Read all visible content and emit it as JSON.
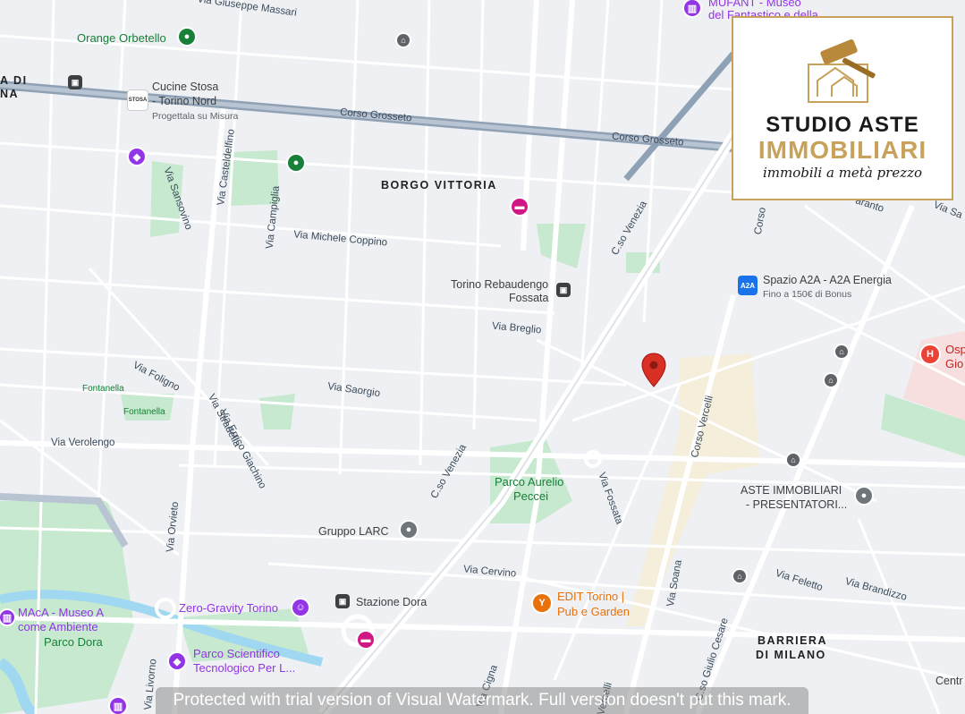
{
  "neighborhoods": {
    "borgo_vittoria": "BORGO VITTORIA",
    "barriera_1": "BARRIERA",
    "barriera_2": "DI MILANO",
    "left_cut_1": "A DI",
    "left_cut_2": "NA"
  },
  "streets": {
    "corso_grosseto_1": "Corso Grosseto",
    "corso_grosseto_2": "Corso Grosseto",
    "via_massari": "Via Giuseppe Massari",
    "via_sansovino": "Via Sansovino",
    "via_castelfino": "Via Casteldelfino",
    "via_campiglia": "Via Campiglia",
    "via_coppino": "Via Michele Coppino",
    "c_venezia_1": "C.so Venezia",
    "c_venezia_2": "C.so Venezia",
    "via_breglio": "Via Breglio",
    "via_foligno": "Via Foligno",
    "via_saorgio": "Via Saorgio",
    "via_stradella": "Via Stradella",
    "via_giachino": "Via Errico Giachino",
    "via_verolengo": "Via Verolengo",
    "via_orvieto": "Via Orvieto",
    "via_livorno": "Via Livorno",
    "via_cervino": "Via Cervino",
    "via_fossata": "Via Fossata",
    "corso_vercelli": "Corso Vercelli",
    "corso_vercelli_2": "Vercelli",
    "via_soana": "Via Soana",
    "via_cigna": "Via Cigna",
    "c_so_cesare": "C.so Giulio Cesare",
    "corso_u": "Corso",
    "via_feletto": "Via Feletto",
    "via_brandizzo": "Via Brandizzo",
    "via_aranto": "aranto",
    "via_sa": "Via Sa"
  },
  "pois": {
    "orange": "Orange Orbetello",
    "cucine_1": "Cucine Stosa",
    "cucine_2": "- Torino Nord",
    "cucine_sub": "Progettala su Misura",
    "stosa_tag": "STOSA",
    "museum_1": "MUFANT - Museo",
    "museum_2": "del Fantastico e della",
    "rebaudengo_1": "Torino Rebaudengo",
    "rebaudengo_2": "Fossata",
    "spazio": "Spazio A2A - A2A Energia",
    "spazio_sub": "Fino a 150€ di Bonus",
    "ospedale_1": "Osp",
    "ospedale_2": "Gio",
    "fontanella_1": "Fontanella",
    "fontanella_2": "Fontanella",
    "parco_aurelio_1": "Parco Aurelio",
    "parco_aurelio_2": "Peccei",
    "gruppo_larc": "Gruppo LARC",
    "aste_1": "ASTE IMMOBILIARI",
    "aste_2": "- PRESENTATORI...",
    "zero_gravity": "Zero-Gravity Torino",
    "stazione_dora": "Stazione Dora",
    "edit_1": "EDIT Torino |",
    "edit_2": "Pub e Garden",
    "maca_1": "MAcA - Museo A",
    "maca_2": "come Ambiente",
    "parco_dora": "Parco Dora",
    "parco_sci_1": "Parco Scientifico",
    "parco_sci_2": "Tecnologico Per L...",
    "centro": "Centr"
  },
  "logo": {
    "line1": "STUDIO ASTE",
    "line2": "IMMOBILIARI",
    "line3": "immobili a metà prezzo"
  },
  "watermark": "Protected with trial version of Visual Watermark. Full version doesn't put this mark.",
  "colors": {
    "map_bg": "#eef0f3",
    "park": "#a8dab5",
    "water": "#9fd8f0",
    "highway": "#8fa1b5",
    "marker": "#d93025",
    "logo_gold": "#c8a15a",
    "poi_purple": "#9334e6",
    "poi_green": "#188038",
    "transit": "#3c4043"
  },
  "icons": {
    "marker": "map-pin-icon",
    "transit": "train-station-icon",
    "museum": "museum-icon",
    "shop": "shopping-icon",
    "hotel": "hotel-icon",
    "bar": "bar-icon",
    "bank": "bank-icon",
    "hospital": "hospital-icon",
    "place": "place-icon"
  }
}
